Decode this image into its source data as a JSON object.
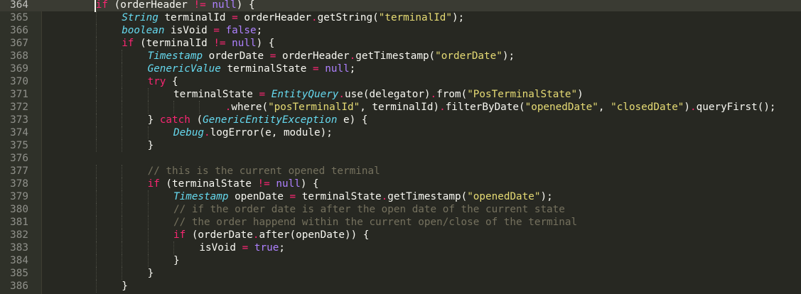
{
  "editor": {
    "first_line": 364,
    "active_line": 364,
    "lines": [
      {
        "ln": "364",
        "indent": 2,
        "tokens": [
          {
            "t": "kw",
            "v": "if"
          },
          {
            "t": "plain",
            "v": " (orderHeader "
          },
          {
            "t": "op",
            "v": "!="
          },
          {
            "t": "plain",
            "v": " "
          },
          {
            "t": "const",
            "v": "null"
          },
          {
            "t": "plain",
            "v": ") {"
          }
        ]
      },
      {
        "ln": "365",
        "indent": 3,
        "tokens": [
          {
            "t": "type",
            "v": "String"
          },
          {
            "t": "plain",
            "v": " terminalId "
          },
          {
            "t": "op",
            "v": "="
          },
          {
            "t": "plain",
            "v": " orderHeader"
          },
          {
            "t": "op",
            "v": "."
          },
          {
            "t": "plain",
            "v": "getString("
          },
          {
            "t": "str",
            "v": "\"terminalId\""
          },
          {
            "t": "plain",
            "v": ");"
          }
        ]
      },
      {
        "ln": "366",
        "indent": 3,
        "tokens": [
          {
            "t": "type",
            "v": "boolean"
          },
          {
            "t": "plain",
            "v": " isVoid "
          },
          {
            "t": "op",
            "v": "="
          },
          {
            "t": "plain",
            "v": " "
          },
          {
            "t": "const",
            "v": "false"
          },
          {
            "t": "plain",
            "v": ";"
          }
        ]
      },
      {
        "ln": "367",
        "indent": 3,
        "tokens": [
          {
            "t": "kw",
            "v": "if"
          },
          {
            "t": "plain",
            "v": " (terminalId "
          },
          {
            "t": "op",
            "v": "!="
          },
          {
            "t": "plain",
            "v": " "
          },
          {
            "t": "const",
            "v": "null"
          },
          {
            "t": "plain",
            "v": ") {"
          }
        ]
      },
      {
        "ln": "368",
        "indent": 4,
        "tokens": [
          {
            "t": "type",
            "v": "Timestamp"
          },
          {
            "t": "plain",
            "v": " orderDate "
          },
          {
            "t": "op",
            "v": "="
          },
          {
            "t": "plain",
            "v": " orderHeader"
          },
          {
            "t": "op",
            "v": "."
          },
          {
            "t": "plain",
            "v": "getTimestamp("
          },
          {
            "t": "str",
            "v": "\"orderDate\""
          },
          {
            "t": "plain",
            "v": ");"
          }
        ]
      },
      {
        "ln": "369",
        "indent": 4,
        "tokens": [
          {
            "t": "type",
            "v": "GenericValue"
          },
          {
            "t": "plain",
            "v": " terminalState "
          },
          {
            "t": "op",
            "v": "="
          },
          {
            "t": "plain",
            "v": " "
          },
          {
            "t": "const",
            "v": "null"
          },
          {
            "t": "plain",
            "v": ";"
          }
        ]
      },
      {
        "ln": "370",
        "indent": 4,
        "tokens": [
          {
            "t": "kw",
            "v": "try"
          },
          {
            "t": "plain",
            "v": " {"
          }
        ]
      },
      {
        "ln": "371",
        "indent": 5,
        "tokens": [
          {
            "t": "plain",
            "v": "terminalState "
          },
          {
            "t": "op",
            "v": "="
          },
          {
            "t": "plain",
            "v": " "
          },
          {
            "t": "type",
            "v": "EntityQuery"
          },
          {
            "t": "op",
            "v": "."
          },
          {
            "t": "plain",
            "v": "use(delegator)"
          },
          {
            "t": "op",
            "v": "."
          },
          {
            "t": "plain",
            "v": "from("
          },
          {
            "t": "str",
            "v": "\"PosTerminalState\""
          },
          {
            "t": "plain",
            "v": ")"
          }
        ]
      },
      {
        "ln": "372",
        "indent": 7,
        "tokens": [
          {
            "t": "op",
            "v": "."
          },
          {
            "t": "plain",
            "v": "where("
          },
          {
            "t": "str",
            "v": "\"posTerminalId\""
          },
          {
            "t": "plain",
            "v": ", terminalId)"
          },
          {
            "t": "op",
            "v": "."
          },
          {
            "t": "plain",
            "v": "filterByDate("
          },
          {
            "t": "str",
            "v": "\"openedDate\""
          },
          {
            "t": "plain",
            "v": ", "
          },
          {
            "t": "str",
            "v": "\"closedDate\""
          },
          {
            "t": "plain",
            "v": ")"
          },
          {
            "t": "op",
            "v": "."
          },
          {
            "t": "plain",
            "v": "queryFirst();"
          }
        ]
      },
      {
        "ln": "373",
        "indent": 4,
        "tokens": [
          {
            "t": "plain",
            "v": "} "
          },
          {
            "t": "kw",
            "v": "catch"
          },
          {
            "t": "plain",
            "v": " ("
          },
          {
            "t": "type",
            "v": "GenericEntityException"
          },
          {
            "t": "plain",
            "v": " e) {"
          }
        ]
      },
      {
        "ln": "374",
        "indent": 5,
        "tokens": [
          {
            "t": "type",
            "v": "Debug"
          },
          {
            "t": "op",
            "v": "."
          },
          {
            "t": "plain",
            "v": "logError(e, module);"
          }
        ]
      },
      {
        "ln": "375",
        "indent": 4,
        "tokens": [
          {
            "t": "plain",
            "v": "}"
          }
        ]
      },
      {
        "ln": "376",
        "indent": 0,
        "tokens": []
      },
      {
        "ln": "377",
        "indent": 4,
        "tokens": [
          {
            "t": "cm",
            "v": "// this is the current opened terminal"
          }
        ]
      },
      {
        "ln": "378",
        "indent": 4,
        "tokens": [
          {
            "t": "kw",
            "v": "if"
          },
          {
            "t": "plain",
            "v": " (terminalState "
          },
          {
            "t": "op",
            "v": "!="
          },
          {
            "t": "plain",
            "v": " "
          },
          {
            "t": "const",
            "v": "null"
          },
          {
            "t": "plain",
            "v": ") {"
          }
        ]
      },
      {
        "ln": "379",
        "indent": 5,
        "tokens": [
          {
            "t": "type",
            "v": "Timestamp"
          },
          {
            "t": "plain",
            "v": " openDate "
          },
          {
            "t": "op",
            "v": "="
          },
          {
            "t": "plain",
            "v": " terminalState"
          },
          {
            "t": "op",
            "v": "."
          },
          {
            "t": "plain",
            "v": "getTimestamp("
          },
          {
            "t": "str",
            "v": "\"openedDate\""
          },
          {
            "t": "plain",
            "v": ");"
          }
        ]
      },
      {
        "ln": "380",
        "indent": 5,
        "tokens": [
          {
            "t": "cm",
            "v": "// if the order date is after the open date of the current state"
          }
        ]
      },
      {
        "ln": "381",
        "indent": 5,
        "tokens": [
          {
            "t": "cm",
            "v": "// the order happend within the current open/close of the terminal"
          }
        ]
      },
      {
        "ln": "382",
        "indent": 5,
        "tokens": [
          {
            "t": "kw",
            "v": "if"
          },
          {
            "t": "plain",
            "v": " (orderDate"
          },
          {
            "t": "op",
            "v": "."
          },
          {
            "t": "plain",
            "v": "after(openDate)) {"
          }
        ]
      },
      {
        "ln": "383",
        "indent": 6,
        "tokens": [
          {
            "t": "plain",
            "v": "isVoid "
          },
          {
            "t": "op",
            "v": "="
          },
          {
            "t": "plain",
            "v": " "
          },
          {
            "t": "const",
            "v": "true"
          },
          {
            "t": "plain",
            "v": ";"
          }
        ]
      },
      {
        "ln": "384",
        "indent": 5,
        "tokens": [
          {
            "t": "plain",
            "v": "}"
          }
        ]
      },
      {
        "ln": "385",
        "indent": 4,
        "tokens": [
          {
            "t": "plain",
            "v": "}"
          }
        ]
      },
      {
        "ln": "386",
        "indent": 3,
        "tokens": [
          {
            "t": "plain",
            "v": "}"
          }
        ]
      }
    ]
  },
  "theme": {
    "background": "#272822",
    "keyword": "#f92672",
    "type": "#66d9ef",
    "string": "#e6db74",
    "constant": "#ae81ff",
    "comment": "#75715e",
    "text": "#f8f8f2"
  }
}
